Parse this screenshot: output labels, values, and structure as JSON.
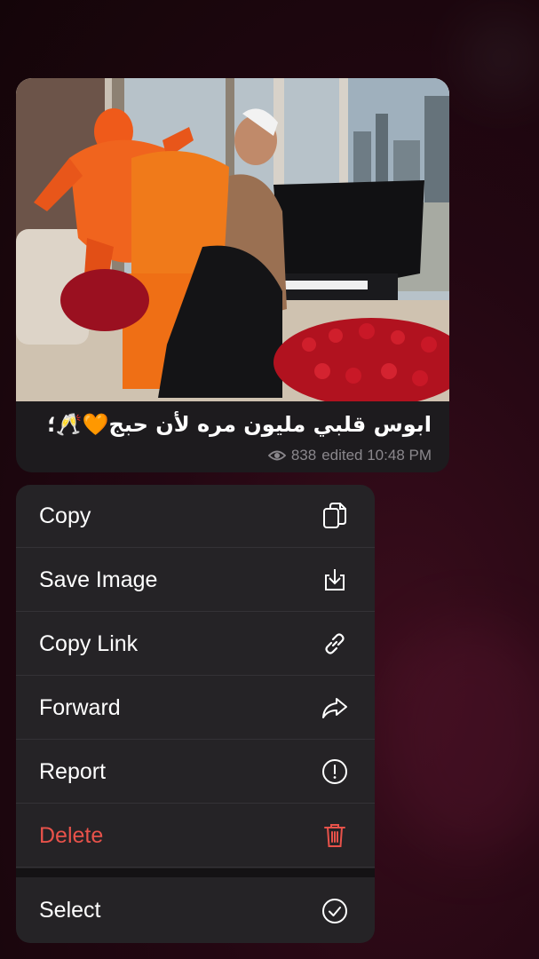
{
  "message": {
    "caption": "ابوس قلبي مليون مره لأن حبج🧡🥂؛",
    "views": "838",
    "status": "edited 10:48 PM"
  },
  "menu": {
    "items": [
      {
        "label": "Copy",
        "icon": "copy-icon"
      },
      {
        "label": "Save Image",
        "icon": "save-image-icon"
      },
      {
        "label": "Copy Link",
        "icon": "link-icon"
      },
      {
        "label": "Forward",
        "icon": "forward-icon"
      },
      {
        "label": "Report",
        "icon": "report-icon"
      },
      {
        "label": "Delete",
        "icon": "trash-icon",
        "color": "#e8524a"
      },
      {
        "label": "Select",
        "icon": "check-circle-icon"
      }
    ]
  },
  "colors": {
    "menu_background": "#252326",
    "bubble_background": "#1d1b1e",
    "danger": "#e8524a"
  }
}
